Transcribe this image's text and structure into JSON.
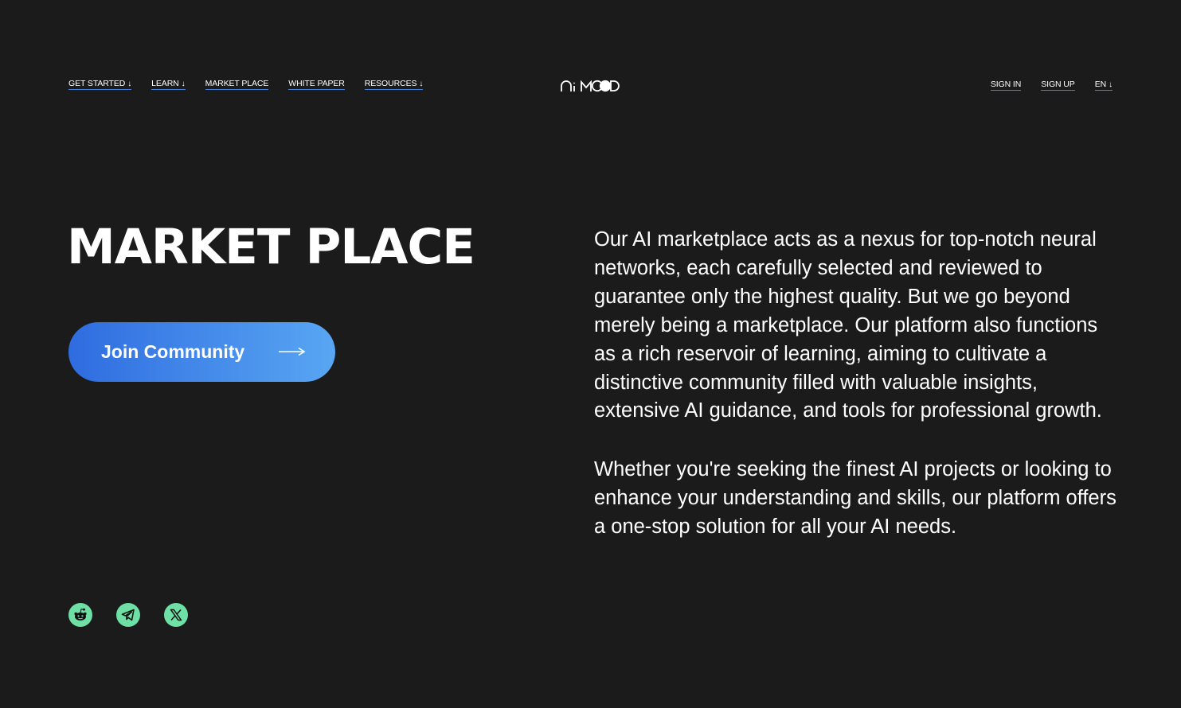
{
  "nav": {
    "left": [
      {
        "label": "GET STARTED",
        "arrow": "↓"
      },
      {
        "label": "LEARN",
        "arrow": "↓"
      },
      {
        "label": "MARKET PLACE",
        "arrow": ""
      },
      {
        "label": "WHITE PAPER",
        "arrow": ""
      },
      {
        "label": "RESOURCES",
        "arrow": "↓"
      }
    ],
    "right": [
      {
        "label": "SIGN IN",
        "arrow": ""
      },
      {
        "label": "SIGN UP",
        "arrow": ""
      },
      {
        "label": "EN",
        "arrow": "↓"
      }
    ]
  },
  "logo": {
    "text": "AiMOOD",
    "icon": "aimood-logo"
  },
  "hero": {
    "title": "MARKET PLACE",
    "cta_label": "Join Community",
    "cta_icon": "arrow-right-icon"
  },
  "description": {
    "paragraph1": "Our AI marketplace acts as a nexus for top-notch neural networks, each carefully selected and reviewed to guarantee only the highest quality. But we go beyond merely being a marketplace. Our platform also functions as a rich reservoir of learning, aiming to cultivate a distinctive community filled with valuable insights, extensive AI guidance, and tools for professional growth.",
    "paragraph2": "Whether you're seeking the finest AI projects or looking to enhance your understanding and skills, our platform offers a one-stop solution for all your AI needs."
  },
  "social": [
    {
      "name": "reddit",
      "icon": "reddit-icon"
    },
    {
      "name": "telegram",
      "icon": "telegram-icon"
    },
    {
      "name": "x",
      "icon": "x-icon"
    }
  ],
  "colors": {
    "background": "#1b1b1b",
    "accent_start": "#2f6ce0",
    "accent_end": "#58a6f3",
    "social_bg": "#6fe0a5",
    "underline": "#4a7fd8"
  }
}
